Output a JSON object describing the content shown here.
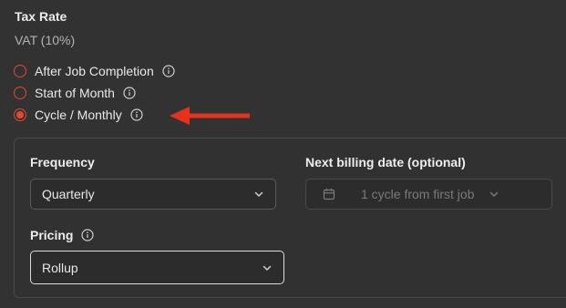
{
  "tax": {
    "label": "Tax Rate",
    "value": "VAT (10%)"
  },
  "billing_options": [
    {
      "label": "After Job Completion",
      "checked": false,
      "icon": "info-icon"
    },
    {
      "label": "Start of Month",
      "checked": false,
      "icon": "info-icon"
    },
    {
      "label": "Cycle / Monthly",
      "checked": true,
      "icon": "info-icon"
    }
  ],
  "frequency": {
    "label": "Frequency",
    "value": "Quarterly"
  },
  "next_billing": {
    "label": "Next billing date (optional)",
    "placeholder": "1 cycle from first job",
    "icon": "calendar-icon"
  },
  "pricing": {
    "label": "Pricing",
    "value": "Rollup",
    "icon": "info-icon"
  },
  "colors": {
    "accent": "#e5482e",
    "annotation_arrow": "#e8311c",
    "background": "#323232"
  }
}
